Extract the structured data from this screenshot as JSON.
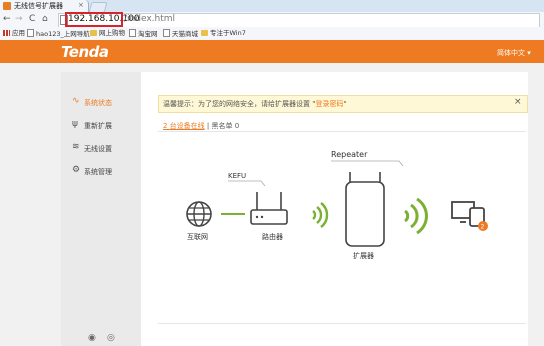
{
  "browser": {
    "tab_title": "无线信号扩展器",
    "tab_close": "×",
    "url_host": "192.168.10.100",
    "url_path": "/index.html",
    "nav": {
      "back": "←",
      "forward": "→",
      "refresh": "C",
      "home": "⌂"
    },
    "bookmarks": [
      {
        "label": "应用",
        "icon": "apps-icon"
      },
      {
        "label": "hao123_上网导航",
        "icon": "page-icon"
      },
      {
        "label": "网上购物",
        "icon": "folder-icon"
      },
      {
        "label": "淘宝网",
        "icon": "page-icon"
      },
      {
        "label": "天猫商城",
        "icon": "page-icon"
      },
      {
        "label": "专注于Win7",
        "icon": "folder-icon"
      }
    ]
  },
  "header": {
    "logo": "Tenda",
    "language": "简体中文 ▾",
    "brand_color": "#ee7a22"
  },
  "sidebar": {
    "items": [
      {
        "label": "系统状态",
        "icon": "pulse-icon",
        "active": true
      },
      {
        "label": "重新扩展",
        "icon": "antenna-icon",
        "active": false
      },
      {
        "label": "无线设置",
        "icon": "wifi-icon",
        "active": false
      },
      {
        "label": "系统管理",
        "icon": "gear-icon",
        "active": false
      }
    ],
    "footer_icons": [
      "weibo-icon",
      "wechat-icon"
    ]
  },
  "main": {
    "notice_prefix": "温馨提示：为了您的网络安全，请给扩展器设置 \"",
    "notice_link": "登录密码",
    "notice_suffix": "\"",
    "notice_close": "×",
    "devices_online": "2 台设备在线",
    "blacklist": " | 黑名单 0",
    "diagram": {
      "internet_label": "互联网",
      "router_ssid": "KEFU",
      "router_label": "路由器",
      "extender_ssid": "Repeater",
      "extender_label": "扩展器",
      "client_count": "2",
      "accent_green": "#7ab133"
    }
  }
}
